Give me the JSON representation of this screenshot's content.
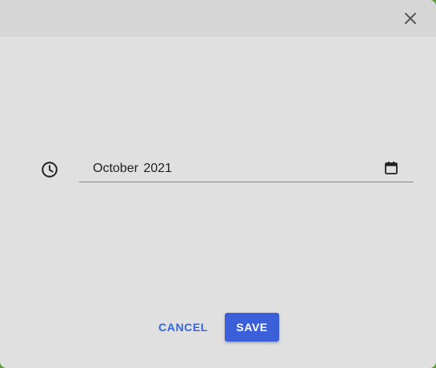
{
  "dialog": {
    "close_icon": "close-icon"
  },
  "form": {
    "time_icon": "clock-icon",
    "date_field": {
      "value": "October 2021",
      "icon": "calendar-icon"
    }
  },
  "actions": {
    "cancel_label": "CANCEL",
    "save_label": "SAVE"
  },
  "colors": {
    "accent": "#3b5fd9",
    "cancel_text": "#3366dd",
    "dialog_bg": "#e0e0e0",
    "header_bg": "#d6d6d6"
  }
}
